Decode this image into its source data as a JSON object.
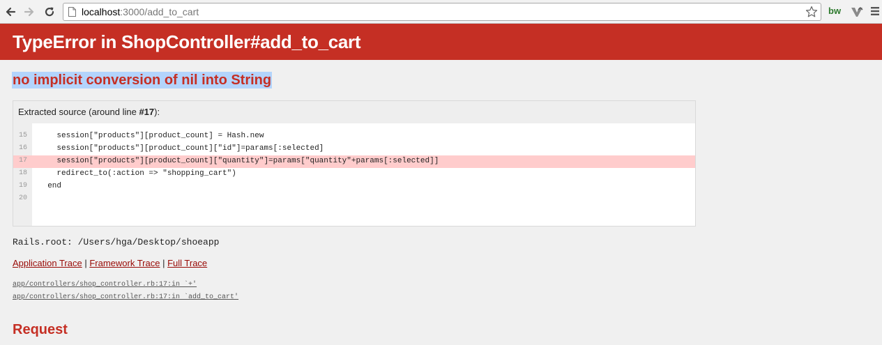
{
  "browser": {
    "url_host": "localhost",
    "url_rest": ":3000/add_to_cart",
    "extension_label": "bw"
  },
  "error": {
    "title": "TypeError in ShopController#add_to_cart",
    "message": "no implicit conversion of nil into String"
  },
  "source": {
    "header_prefix": "Extracted source (around line ",
    "header_line": "#17",
    "header_suffix": "):",
    "lines": [
      {
        "num": "15",
        "code": "    session[\"products\"][product_count] = Hash.new"
      },
      {
        "num": "16",
        "code": "    session[\"products\"][product_count][\"id\"]=params[:selected]"
      },
      {
        "num": "17",
        "code": "    session[\"products\"][product_count][\"quantity\"]=params[\"quantity\"+params[:selected]]"
      },
      {
        "num": "18",
        "code": "    redirect_to(:action => \"shopping_cart\")"
      },
      {
        "num": "19",
        "code": "  end"
      },
      {
        "num": "20",
        "code": ""
      }
    ]
  },
  "rails_root": "Rails.root: /Users/hga/Desktop/shoeapp",
  "trace": {
    "application_label": "Application Trace",
    "framework_label": "Framework Trace",
    "full_label": "Full Trace",
    "separator": " | ",
    "items": [
      "app/controllers/shop_controller.rb:17:in `+'",
      "app/controllers/shop_controller.rb:17:in `add_to_cart'"
    ]
  },
  "request_heading": "Request",
  "colors": {
    "header_red": "#c52f24",
    "highlight_line": "#ffcccc",
    "selection": "#b3d4fc",
    "link": "#980905"
  }
}
